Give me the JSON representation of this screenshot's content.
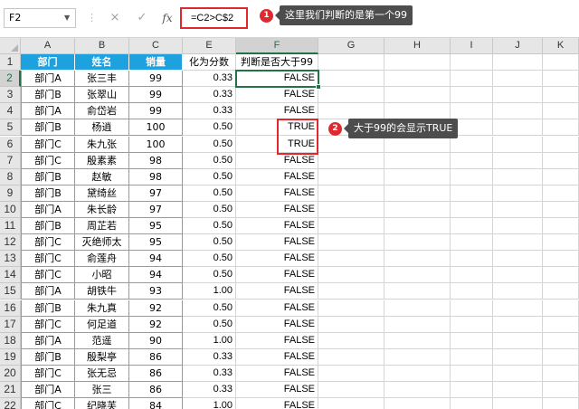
{
  "formula_bar": {
    "name_box": "F2",
    "formula": "=C2>C$2",
    "cancel_icon": "×",
    "confirm_icon": "✓",
    "fx_label": "fx"
  },
  "callouts": [
    {
      "num": "1",
      "text": "这里我们判断的是第一个99"
    },
    {
      "num": "2",
      "text": "大于99的会显示TRUE"
    }
  ],
  "columns": [
    "A",
    "B",
    "C",
    "E",
    "F",
    "G",
    "H",
    "I",
    "J",
    "K"
  ],
  "rows": [
    "1",
    "2",
    "3",
    "4",
    "5",
    "6",
    "7",
    "8",
    "9",
    "10",
    "11",
    "12",
    "13",
    "14",
    "15",
    "16",
    "17",
    "18",
    "19",
    "20",
    "21",
    "22"
  ],
  "headers": {
    "A": "部门",
    "B": "姓名",
    "C": "销量",
    "E": "化为分数",
    "F": "判断是否大于99"
  },
  "data": [
    [
      "部门A",
      "张三丰",
      "99",
      "0.33",
      "FALSE"
    ],
    [
      "部门B",
      "张翠山",
      "99",
      "0.33",
      "FALSE"
    ],
    [
      "部门A",
      "俞岱岩",
      "99",
      "0.33",
      "FALSE"
    ],
    [
      "部门B",
      "杨逍",
      "100",
      "0.50",
      "TRUE"
    ],
    [
      "部门C",
      "朱九张",
      "100",
      "0.50",
      "TRUE"
    ],
    [
      "部门C",
      "殷素素",
      "98",
      "0.50",
      "FALSE"
    ],
    [
      "部门B",
      "赵敏",
      "98",
      "0.50",
      "FALSE"
    ],
    [
      "部门B",
      "黛绮丝",
      "97",
      "0.50",
      "FALSE"
    ],
    [
      "部门A",
      "朱长龄",
      "97",
      "0.50",
      "FALSE"
    ],
    [
      "部门B",
      "周芷若",
      "95",
      "0.50",
      "FALSE"
    ],
    [
      "部门C",
      "灭绝师太",
      "95",
      "0.50",
      "FALSE"
    ],
    [
      "部门C",
      "俞莲舟",
      "94",
      "0.50",
      "FALSE"
    ],
    [
      "部门C",
      "小昭",
      "94",
      "0.50",
      "FALSE"
    ],
    [
      "部门A",
      "胡铁牛",
      "93",
      "1.00",
      "FALSE"
    ],
    [
      "部门B",
      "朱九真",
      "92",
      "0.50",
      "FALSE"
    ],
    [
      "部门C",
      "何足道",
      "92",
      "0.50",
      "FALSE"
    ],
    [
      "部门A",
      "范遥",
      "90",
      "1.00",
      "FALSE"
    ],
    [
      "部门B",
      "殷梨亭",
      "86",
      "0.33",
      "FALSE"
    ],
    [
      "部门C",
      "张无忌",
      "86",
      "0.33",
      "FALSE"
    ],
    [
      "部门A",
      "张三",
      "86",
      "0.33",
      "FALSE"
    ],
    [
      "部门C",
      "纪晓芙",
      "84",
      "1.00",
      "FALSE"
    ]
  ],
  "colors": {
    "header_fill": "#1ea1df",
    "accent_red": "#e0282e",
    "selection_green": "#217346"
  }
}
